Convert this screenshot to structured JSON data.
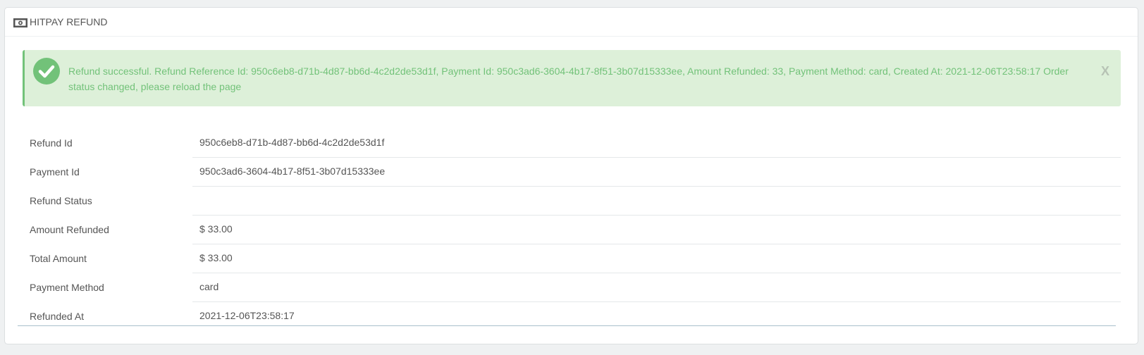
{
  "panel": {
    "title": "HITPAY REFUND",
    "icon": "money-icon"
  },
  "alert": {
    "message": "Refund successful. Refund Reference Id: 950c6eb8-d71b-4d87-bb6d-4c2d2de53d1f, Payment Id: 950c3ad6-3604-4b17-8f51-3b07d15333ee, Amount Refunded: 33, Payment Method: card, Created At: 2021-12-06T23:58:17 Order status changed, please reload the page",
    "close_label": "X",
    "icon": "check-circle-icon",
    "color": "#72c279",
    "background": "#ddf0d9"
  },
  "details": {
    "rows": [
      {
        "label": "Refund Id",
        "value": "950c6eb8-d71b-4d87-bb6d-4c2d2de53d1f"
      },
      {
        "label": "Payment Id",
        "value": "950c3ad6-3604-4b17-8f51-3b07d15333ee"
      },
      {
        "label": "Refund Status",
        "value": ""
      },
      {
        "label": "Amount Refunded",
        "value": "$ 33.00"
      },
      {
        "label": "Total Amount",
        "value": "$ 33.00"
      },
      {
        "label": "Payment Method",
        "value": "card"
      },
      {
        "label": "Refunded At",
        "value": "2021-12-06T23:58:17"
      }
    ]
  }
}
